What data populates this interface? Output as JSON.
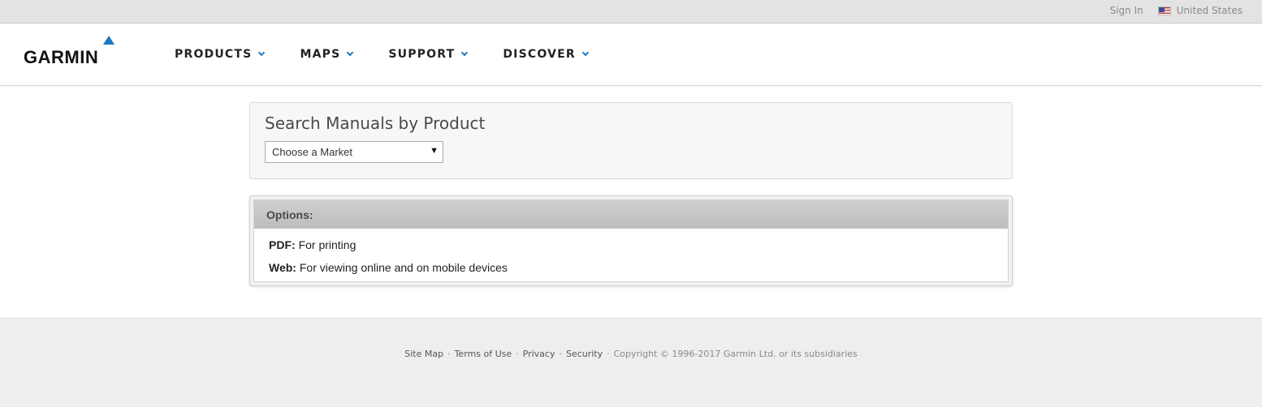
{
  "topbar": {
    "signin_label": "Sign In",
    "region_label": "United States",
    "flag_icon": "us-flag-icon"
  },
  "header": {
    "logo_text": "GARMIN",
    "brand_color": "#1a79c1",
    "nav": [
      {
        "label": "PRODUCTS"
      },
      {
        "label": "MAPS"
      },
      {
        "label": "SUPPORT"
      },
      {
        "label": "DISCOVER"
      }
    ]
  },
  "search": {
    "title": "Search Manuals by Product",
    "market_select_value": "Choose a Market"
  },
  "options": {
    "heading": "Options:",
    "items": [
      {
        "label": "PDF:",
        "desc": "For printing"
      },
      {
        "label": "Web:",
        "desc": "For viewing online and on mobile devices"
      }
    ]
  },
  "footer": {
    "links": [
      "Site Map",
      "Terms of Use",
      "Privacy",
      "Security"
    ],
    "separator": "·",
    "copyright": "Copyright © 1996-2017 Garmin Ltd. or its subsidiaries"
  }
}
